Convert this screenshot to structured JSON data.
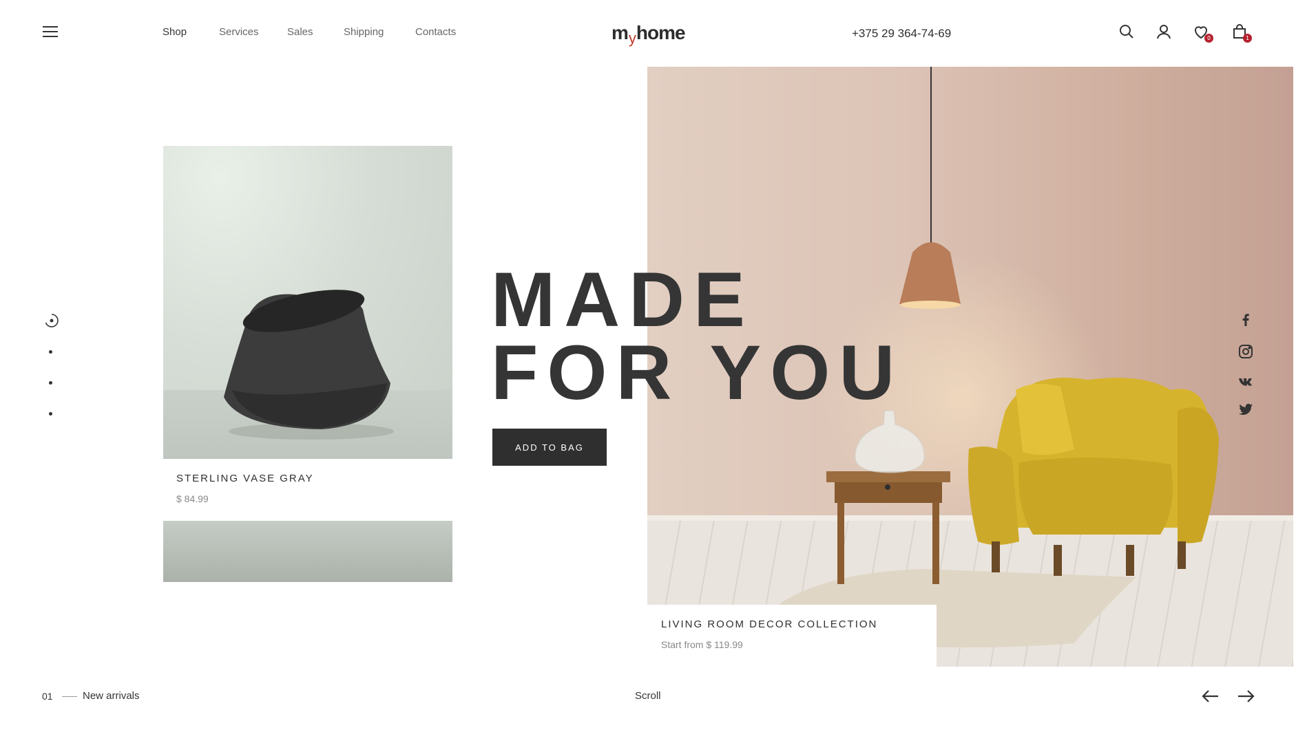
{
  "header": {
    "nav": [
      "Shop",
      "Services",
      "Sales",
      "Shipping",
      "Contacts"
    ],
    "logo_left": "m",
    "logo_y": "y",
    "logo_right": "home",
    "phone": "+375 29 364-74-69",
    "wishlist_count": "0",
    "cart_count": "1"
  },
  "product": {
    "name": "STERLING VASE GRAY",
    "price": "$ 84.99"
  },
  "hero": {
    "line1": "MADE",
    "line2": "FOR YOU",
    "cta": "ADD TO BAG"
  },
  "collection": {
    "title": "LIVING ROOM DECOR COLLECTION",
    "subtitle": "Start from $ 119.99"
  },
  "footer": {
    "slide_number": "01",
    "slide_label": "New arrivals",
    "scroll": "Scroll"
  },
  "colors": {
    "text_dark": "#2f2f2f",
    "badge": "#b5222e",
    "accent_logo": "#c0392b",
    "armchair": "#d6b32c"
  }
}
